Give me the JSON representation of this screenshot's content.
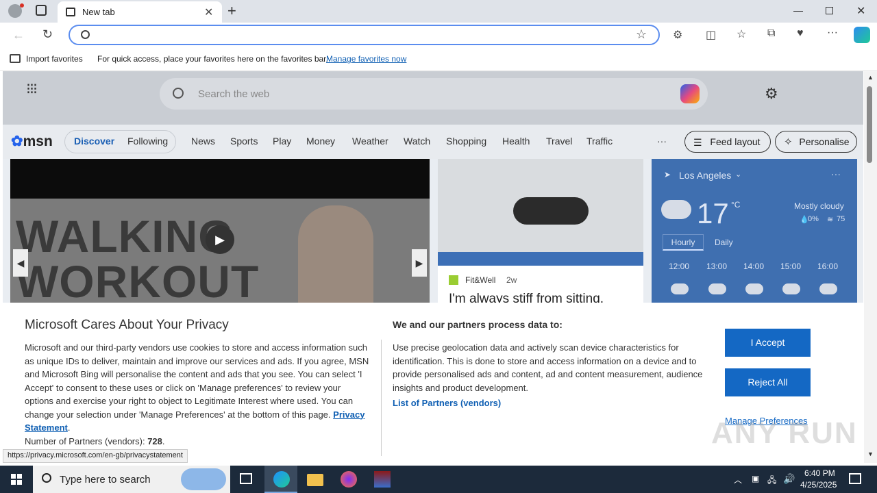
{
  "browser": {
    "tab_title": "New tab",
    "fav_import": "Import favorites",
    "fav_message": "For quick access, place your favorites here on the favorites bar.",
    "fav_manage": "Manage favorites now",
    "status_url": "https://privacy.microsoft.com/en-gb/privacystatement"
  },
  "msn": {
    "search_placeholder": "Search the web",
    "logo": "msn",
    "nav_discover": "Discover",
    "nav_following": "Following",
    "nav_items": [
      "News",
      "Sports",
      "Play",
      "Money",
      "Weather",
      "Watch",
      "Shopping",
      "Health",
      "Travel",
      "Traffic"
    ],
    "more": "···",
    "feed_layout": "Feed layout",
    "personalise": "Personalise",
    "hero_line1": "WALKING",
    "hero_line2": "WORKOUT",
    "card2_source": "Fit&Well",
    "card2_age": "2w",
    "card2_headline": "I'm always stiff from sitting,",
    "weather": {
      "location": "Los Angeles",
      "temp": "17",
      "unit": "°C",
      "condition": "Mostly cloudy",
      "precip": "0%",
      "humidity": "75",
      "tab_hourly": "Hourly",
      "tab_daily": "Daily",
      "hours": [
        "12:00",
        "13:00",
        "14:00",
        "15:00",
        "16:00"
      ]
    }
  },
  "privacy": {
    "title": "Microsoft Cares About Your Privacy",
    "body": "Microsoft and our third-party vendors use cookies to store and access information such as unique IDs to deliver, maintain and improve our services and ads. If you agree, MSN and Microsoft Bing will personalise the content and ads that you see. You can select 'I Accept' to consent to these uses or click on 'Manage preferences' to review your options and exercise your right to object to Legitimate Interest where used.  You can change your selection under 'Manage Preferences' at the bottom of this page.",
    "privacy_statement": "Privacy Statement",
    "partners_label": "Number of Partners (vendors):",
    "partners_count": "728",
    "subtitle": "We and our partners process data to:",
    "body2": "Use precise geolocation data and actively scan device characteristics for identification. This is done to store and access information on a device and to provide personalised ads and content, ad and content measurement, audience insights and product development.",
    "list_partners": "List of Partners (vendors)",
    "accept": "I Accept",
    "reject": "Reject All",
    "manage": "Manage Preferences"
  },
  "taskbar": {
    "search_placeholder": "Type here to search",
    "time": "6:40 PM",
    "date": "4/25/2025"
  },
  "watermark": "ANY RUN"
}
